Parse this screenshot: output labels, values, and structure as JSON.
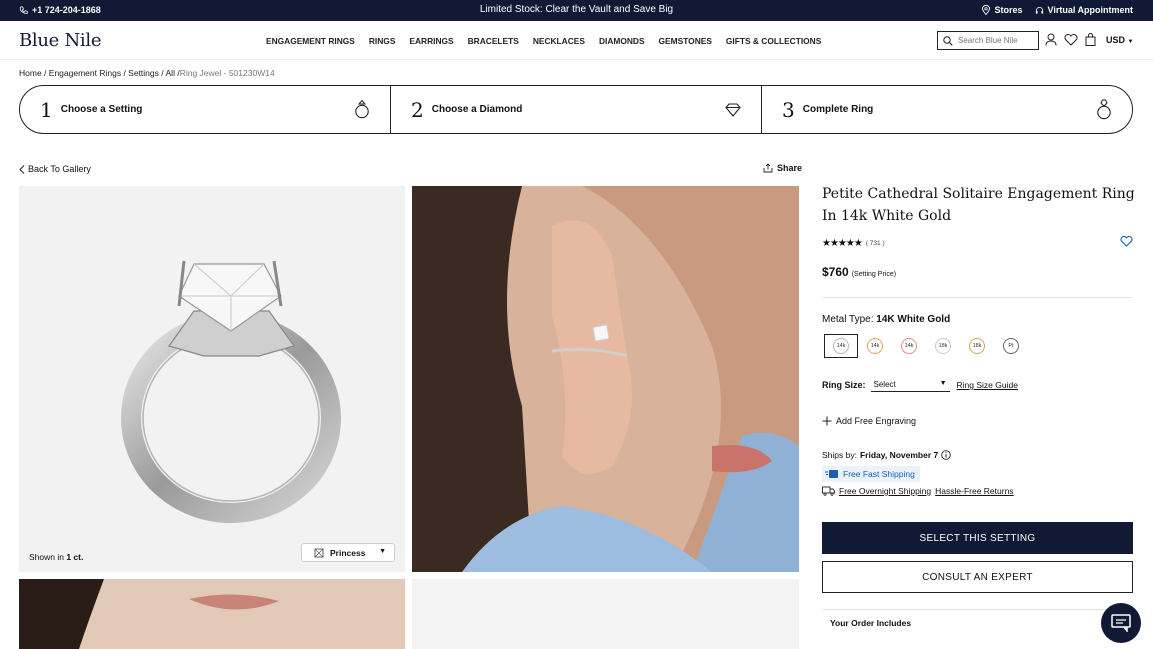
{
  "topbar": {
    "phone": "+1 724-204-1868",
    "promo": "Limited Stock: Clear the Vault and Save Big",
    "stores": "Stores",
    "virtual": "Virtual Appointment"
  },
  "header": {
    "logo": "Blue Nile",
    "nav": [
      "ENGAGEMENT RINGS",
      "RINGS",
      "EARRINGS",
      "BRACELETS",
      "NECKLACES",
      "DIAMONDS",
      "GEMSTONES",
      "GIFTS & COLLECTIONS"
    ],
    "search_placeholder": "Search Blue Nile",
    "currency": "USD"
  },
  "breadcrumb": {
    "items": [
      "Home",
      "Engagement Rings",
      "Settings",
      "All"
    ],
    "current": "Ring Jewel - 501230W14"
  },
  "steps": [
    {
      "num": "1",
      "label": "Choose a Setting"
    },
    {
      "num": "2",
      "label": "Choose a Diamond"
    },
    {
      "num": "3",
      "label": "Complete Ring"
    }
  ],
  "gallery": {
    "back": "Back To Gallery",
    "share": "Share",
    "shown_in_prefix": "Shown in ",
    "shown_in_value": "1 ct.",
    "shape": "Princess"
  },
  "product": {
    "title": "Petite Cathedral Solitaire Engagement Ring In 14k White Gold",
    "stars": "★★★★★",
    "review_count": "( 731 )",
    "price": "$760",
    "price_note": "(Setting Price)",
    "metal_label": "Metal Type:",
    "metal_value": "14K White Gold",
    "metals": [
      {
        "label": "14k",
        "ring": "#b8b8b8"
      },
      {
        "label": "14k",
        "ring": "#e0a35a"
      },
      {
        "label": "14k",
        "ring": "#e3907a"
      },
      {
        "label": "18k",
        "ring": "#c8c8c8"
      },
      {
        "label": "18k",
        "ring": "#e0a35a"
      },
      {
        "label": "Pt",
        "ring": "#666666"
      }
    ],
    "ring_size_label": "Ring Size:",
    "ring_size_value": "Select",
    "ring_size_guide": "Ring Size Guide",
    "engraving": "Add Free Engraving",
    "ships_by_label": "Ships by:",
    "ships_by_date": "Friday, November 7",
    "fast_shipping": "Free Fast Shipping",
    "overnight": "Free Overnight Shipping",
    "returns": "Hassle-Free Returns",
    "select_button": "SELECT THIS SETTING",
    "consult_button": "CONSULT AN EXPERT",
    "order_includes": "Your Order Includes"
  },
  "colors": {
    "navy": "#101a34",
    "accent_blue": "#1a5fb4"
  }
}
